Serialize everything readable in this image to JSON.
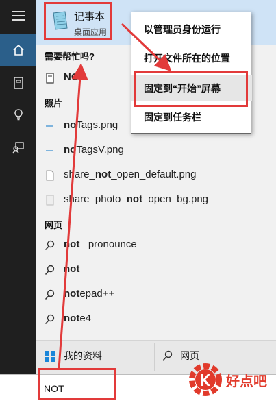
{
  "best_match": {
    "title": "记事本",
    "subtitle": "桌面应用"
  },
  "sections": {
    "help": "需要帮忙吗?",
    "photos": "照片",
    "web": "网页"
  },
  "results": {
    "help_item": {
      "bold": "NOT",
      "rest": ""
    },
    "photos": [
      {
        "pre": "",
        "bold": "no",
        "mid": "Tags.png",
        "rest": ""
      },
      {
        "pre": "",
        "bold": "no",
        "mid": "TagsV.png",
        "rest": ""
      },
      {
        "pre": "share_",
        "bold": "not",
        "mid": "_open_default.png",
        "rest": ""
      },
      {
        "pre": "share_photo_",
        "bold": "not",
        "mid": "_open_bg.png",
        "rest": ""
      }
    ],
    "web": [
      {
        "bold": "not",
        "rest": "   pronounce"
      },
      {
        "bold": "not",
        "rest": ""
      },
      {
        "bold": "not",
        "rest": "epad++"
      },
      {
        "bold": "not",
        "rest": "e4"
      }
    ]
  },
  "bottom": {
    "my_stuff": "我的资料",
    "web": "网页"
  },
  "search": {
    "value": "NOT"
  },
  "context_menu": {
    "items": [
      "以管理员身份运行",
      "打开文件所在的位置",
      "固定到“开始”屏幕",
      "固定到任务栏"
    ]
  },
  "watermark": {
    "text": "好点吧"
  },
  "colors": {
    "accent": "#2b5f8a",
    "annotation_red": "#e23a3a"
  }
}
